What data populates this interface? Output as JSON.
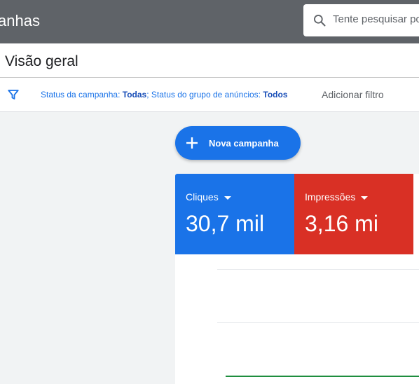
{
  "topbar": {
    "title": "anhas",
    "search": {
      "placeholder": "Tente pesquisar po"
    }
  },
  "page": {
    "title": "Visão geral"
  },
  "filters": {
    "campaign_status_label": "Status da campanha:",
    "campaign_status_value": "Todas",
    "separator": ";",
    "adgroup_status_label": "Status do grupo de anúncios:",
    "adgroup_status_value": "Todos",
    "add_filter_label": "Adicionar filtro"
  },
  "fab": {
    "label": "Nova campanha"
  },
  "metrics": [
    {
      "label": "Cliques",
      "value": "30,7 mil",
      "color": "#1a73e8"
    },
    {
      "label": "Impressões",
      "value": "3,16 mi",
      "color": "#d93025"
    }
  ],
  "colors": {
    "topbar": "#5f6368",
    "accent": "#1a73e8",
    "series_line": "#1e8e3e"
  },
  "icons": {
    "search": "search-icon",
    "filter": "filter-icon",
    "fab": "plus-icon",
    "dropdown": "caret-down-icon"
  }
}
